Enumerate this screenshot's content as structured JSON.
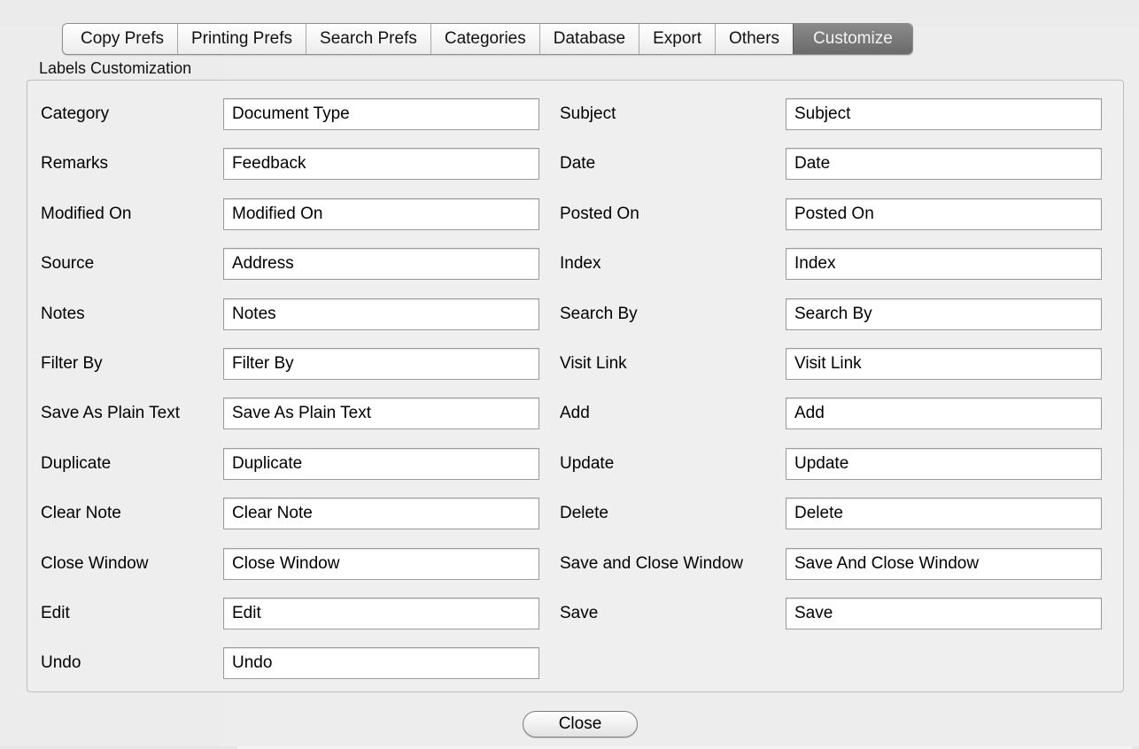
{
  "tabs": [
    {
      "label": "Copy Prefs",
      "selected": false
    },
    {
      "label": "Printing Prefs",
      "selected": false
    },
    {
      "label": "Search Prefs",
      "selected": false
    },
    {
      "label": "Categories",
      "selected": false
    },
    {
      "label": "Database",
      "selected": false
    },
    {
      "label": "Export",
      "selected": false
    },
    {
      "label": "Others",
      "selected": false
    },
    {
      "label": "Customize",
      "selected": true
    }
  ],
  "section_title": "Labels Customization",
  "left_fields": [
    {
      "label": "Category",
      "value": "Document Type"
    },
    {
      "label": "Remarks",
      "value": "Feedback"
    },
    {
      "label": "Modified On",
      "value": "Modified On"
    },
    {
      "label": "Source",
      "value": "Address"
    },
    {
      "label": "Notes",
      "value": "Notes"
    },
    {
      "label": "Filter By",
      "value": "Filter By"
    },
    {
      "label": "Save As Plain Text",
      "value": "Save As Plain Text"
    },
    {
      "label": "Duplicate",
      "value": "Duplicate"
    },
    {
      "label": "Clear Note",
      "value": "Clear Note"
    },
    {
      "label": "Close Window",
      "value": "Close Window"
    },
    {
      "label": "Edit",
      "value": "Edit"
    },
    {
      "label": "Undo",
      "value": "Undo"
    }
  ],
  "right_fields": [
    {
      "label": "Subject",
      "value": "Subject"
    },
    {
      "label": "Date",
      "value": "Date"
    },
    {
      "label": "Posted On",
      "value": "Posted On"
    },
    {
      "label": "Index",
      "value": "Index"
    },
    {
      "label": "Search By",
      "value": "Search By"
    },
    {
      "label": "Visit Link",
      "value": "Visit Link"
    },
    {
      "label": "Add",
      "value": "Add"
    },
    {
      "label": "Update",
      "value": "Update"
    },
    {
      "label": "Delete",
      "value": "Delete"
    },
    {
      "label": "Save and Close Window",
      "value": "Save And Close Window"
    },
    {
      "label": "Save",
      "value": "Save"
    }
  ],
  "close_label": "Close",
  "colors": {
    "selected_tab": "#787878",
    "sheet": "#ececec"
  }
}
